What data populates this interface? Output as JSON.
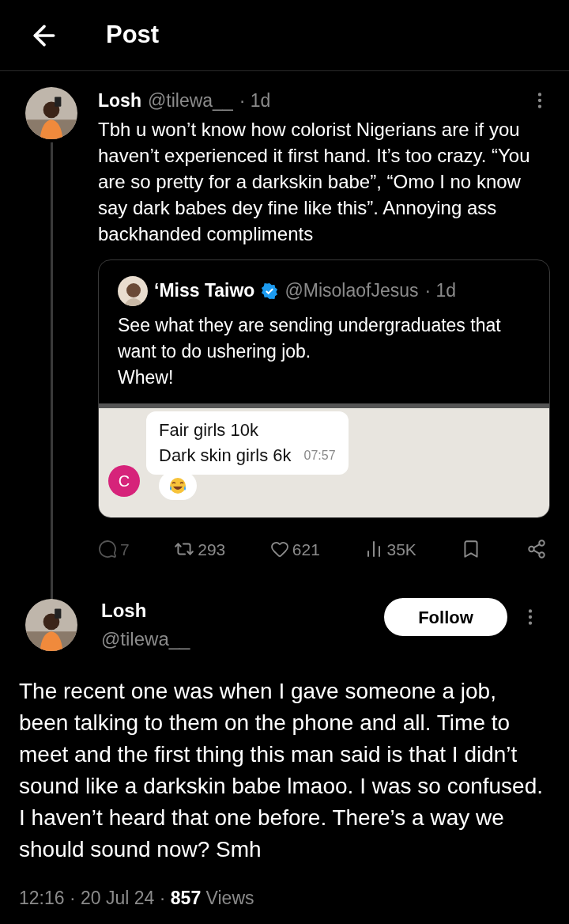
{
  "header": {
    "title": "Post"
  },
  "parent_post": {
    "name": "Losh",
    "handle": "@tilewa__",
    "time": "· 1d",
    "text": "Tbh u won’t know how colorist Nigerians are if you haven’t experienced it first hand. It’s too crazy. “You are so pretty for a darkskin babe”, “Omo I no know say dark babes dey fine like this”. Annoying ass backhanded compliments",
    "quote": {
      "name": "‘Miss Taiwo",
      "verified": true,
      "handle": "@MisolaofJesus",
      "time": "· 1d",
      "paragraphs": [
        "See what they are sending undergraduates that want to do ushering job.",
        "Whew!"
      ],
      "chat": {
        "avatar_letter": "C",
        "lines": [
          "Fair girls 10k",
          "Dark skin girls 6k"
        ],
        "time": "07:57"
      }
    },
    "stats": [
      {
        "kind": "reply",
        "count": "7"
      },
      {
        "kind": "repost",
        "count": "293"
      },
      {
        "kind": "like",
        "count": "621"
      },
      {
        "kind": "views",
        "count": "35K"
      },
      {
        "kind": "bookmark"
      },
      {
        "kind": "share"
      }
    ]
  },
  "main_post": {
    "name": "Losh",
    "handle": "@tilewa__",
    "follow_label": "Follow",
    "text": "The recent one was when I gave someone a job, been talking to them on the phone and all. Time to meet and the first thing this man said is that I didn’t sound like a darkskin babe lmaoo. I was so confused. I haven’t heard that one before. There’s a way we should sound now? Smh",
    "timestamp": "12:16 · 20 Jul 24 · ",
    "views_count": "857",
    "views_label": "Views"
  }
}
